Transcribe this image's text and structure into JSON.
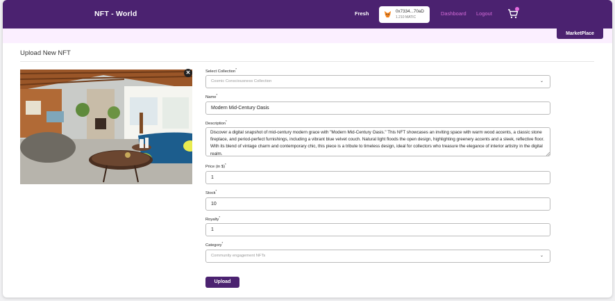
{
  "header": {
    "brand": "NFT - World",
    "username": "Fresh",
    "wallet": {
      "address": "0x7334...70aD",
      "balance": "1.210 MATIC"
    },
    "nav": {
      "dashboard": "Dashboard",
      "logout": "Logout"
    },
    "marketplace_label": "MarketPlace",
    "accent": "#4b2270",
    "link_color": "#d46bd8"
  },
  "form": {
    "title": "Upload New NFT",
    "collection": {
      "label": "Select Collection",
      "value": "Cosmic Consciousness Collection"
    },
    "name": {
      "label": "Name",
      "value": "Modern Mid-Century Oasis"
    },
    "description": {
      "label": "Description",
      "value": "Discover a digital snapshot of mid-century modern grace with \"Modern Mid-Century Oasis.\" This NFT showcases an inviting space with warm wood accents, a classic stone fireplace, and period-perfect furnishings, including a vibrant blue velvet couch. Natural light floods the open design, highlighting greenery accents and a sleek, reflective floor. With its blend of vintage charm and contemporary chic, this piece is a tribute to timeless design, ideal for collectors who treasure the elegance of interior artistry in the digital realm."
    },
    "price": {
      "label": "Price (in $)",
      "value": "1"
    },
    "stock": {
      "label": "Stock",
      "value": "10"
    },
    "royalty": {
      "label": "Royalty",
      "value": "1"
    },
    "category": {
      "label": "Category",
      "value": "Community engagement NFTs"
    },
    "required_mark": "*",
    "upload_label": "Upload"
  },
  "icons": {
    "wallet": "metamask-fox-icon",
    "cart": "shopping-cart-icon",
    "remove": "close-icon",
    "dropdown": "chevron-down-icon"
  }
}
